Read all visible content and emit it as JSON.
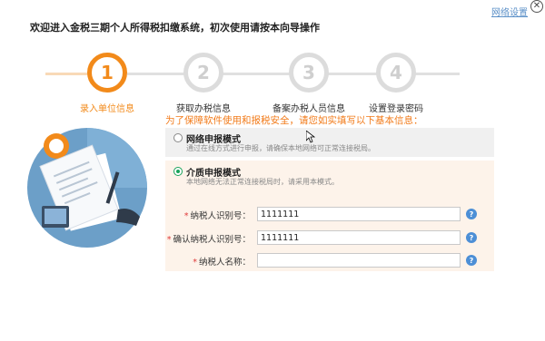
{
  "header": {
    "network_settings": "网络设置",
    "close_glyph": "✕",
    "welcome": "欢迎进入金税三期个人所得税扣缴系统，初次使用请按本向导操作"
  },
  "steps": [
    {
      "number": "1",
      "label": "录入单位信息",
      "active": true
    },
    {
      "number": "2",
      "label": "获取办税信息",
      "active": false
    },
    {
      "number": "3",
      "label": "备案办税人员信息",
      "active": false
    },
    {
      "number": "4",
      "label": "设置登录密码",
      "active": false
    }
  ],
  "notice": "为了保障软件使用和报税安全，请您如实填写以下基本信息：",
  "modes": {
    "online": {
      "title": "网络申报模式",
      "desc": "通过在线方式进行申报，请确保本地网络可正常连接税局。",
      "selected": false
    },
    "media": {
      "title": "介质申报模式",
      "desc": "本地网络无法正常连接税局时，请采用本模式。",
      "selected": true
    }
  },
  "form": {
    "required_mark": "*",
    "taxpayer_id_label": "纳税人识别号：",
    "taxpayer_id_value": "1111111",
    "confirm_id_label": "确认纳税人识别号：",
    "confirm_id_value": "1111111",
    "taxpayer_name_label": "纳税人名称：",
    "taxpayer_name_value": "",
    "help_glyph": "?"
  },
  "colors": {
    "accent": "#f28a1a",
    "inactive": "#dcdcdc",
    "selected_radio": "#18a35a",
    "help": "#4d8fd6"
  }
}
